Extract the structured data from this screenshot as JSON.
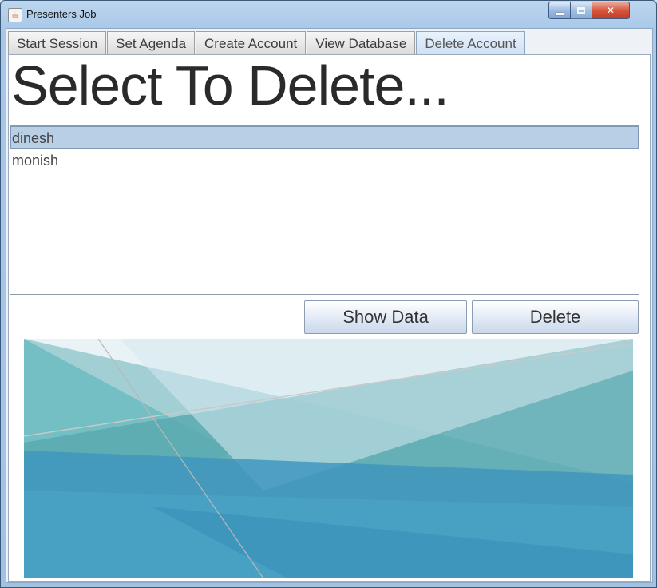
{
  "window": {
    "title": "Presenters Job",
    "icon": "java-cup-icon"
  },
  "tabs": [
    {
      "label": "Start Session"
    },
    {
      "label": "Set Agenda"
    },
    {
      "label": "Create Account"
    },
    {
      "label": "View Database"
    },
    {
      "label": "Delete Account",
      "active": true
    }
  ],
  "heading": "Select To Delete...",
  "accounts": [
    {
      "name": "dinesh",
      "selected": true
    },
    {
      "name": "monish",
      "selected": false
    }
  ],
  "buttons": {
    "show_data": "Show Data",
    "delete": "Delete"
  },
  "colors": {
    "selection": "#b8cfe6",
    "art_primary": "#3f97bd",
    "art_teal": "#5aa9b0"
  }
}
